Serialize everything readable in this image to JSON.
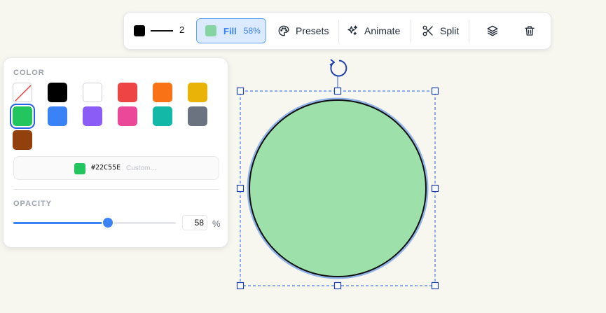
{
  "toolbar": {
    "stroke_color": "#000000",
    "stroke_width": "2",
    "fill_label": "Fill",
    "fill_opacity": "58%",
    "fill_color": "#86d4a4",
    "presets_label": "Presets",
    "animate_label": "Animate",
    "split_label": "Split",
    "icons": [
      "palette-icon",
      "sparkles-icon",
      "scissors-icon",
      "layers-icon",
      "trash-icon"
    ]
  },
  "color_panel": {
    "color_title": "COLOR",
    "swatches": [
      {
        "name": "none",
        "color": "none"
      },
      {
        "name": "black",
        "color": "#000000"
      },
      {
        "name": "white",
        "color": "#ffffff"
      },
      {
        "name": "red",
        "color": "#ef4444"
      },
      {
        "name": "orange",
        "color": "#f97316"
      },
      {
        "name": "yellow",
        "color": "#eab308"
      },
      {
        "name": "green",
        "color": "#22c55e",
        "selected": true
      },
      {
        "name": "blue",
        "color": "#3b82f6"
      },
      {
        "name": "purple",
        "color": "#8b5cf6"
      },
      {
        "name": "pink",
        "color": "#ec4899"
      },
      {
        "name": "teal",
        "color": "#14b8a6"
      },
      {
        "name": "gray",
        "color": "#6b7280"
      },
      {
        "name": "brown",
        "color": "#92400e"
      }
    ],
    "hex_value": "#22C55E",
    "custom_placeholder": "Custom...",
    "opacity_title": "OPACITY",
    "opacity_value": "58",
    "opacity_unit": "%",
    "opacity_fraction": 0.58
  },
  "shape": {
    "type": "circle",
    "fill": "#9ee0a9",
    "stroke": "#111111",
    "selection_color": "#2563eb"
  }
}
